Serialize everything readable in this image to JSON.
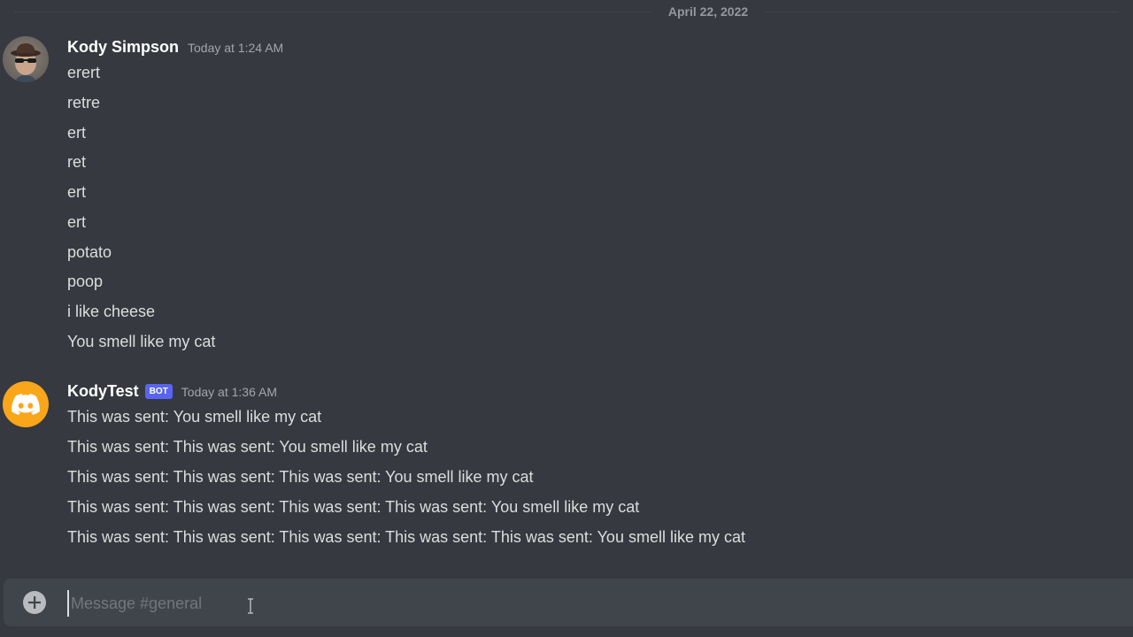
{
  "date_divider": "April 22, 2022",
  "colors": {
    "background": "#36393f",
    "composer_bg": "#40444b",
    "bot_tag": "#5865f2",
    "bot_avatar": "#faa61a",
    "username": "#ffffff",
    "text": "#dcddde",
    "muted": "#a3a6aa"
  },
  "messages": [
    {
      "author": "Kody Simpson",
      "avatar_icon": "user-avatar-icon",
      "is_bot": false,
      "timestamp": "Today at 1:24 AM",
      "lines": [
        "erert",
        "retre",
        "ert",
        "ret",
        "ert",
        "ert",
        "potato",
        "poop",
        "i like cheese",
        "You smell like my cat"
      ]
    },
    {
      "author": "KodyTest",
      "avatar_icon": "discord-logo-icon",
      "is_bot": true,
      "bot_tag": "BOT",
      "timestamp": "Today at 1:36 AM",
      "lines": [
        "This was sent: You smell like my cat",
        "This was sent: This was sent: You smell like my cat",
        "This was sent: This was sent: This was sent: You smell like my cat",
        "This was sent: This was sent: This was sent: This was sent: You smell like my cat",
        "This was sent: This was sent: This was sent: This was sent: This was sent: You smell like my cat"
      ]
    }
  ],
  "composer": {
    "placeholder": "Message #general",
    "value": "",
    "attach_icon": "plus-circle-icon"
  }
}
